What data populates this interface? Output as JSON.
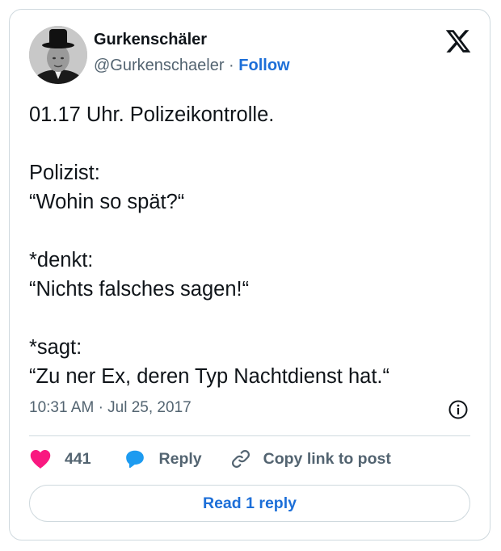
{
  "author": {
    "name": "Gurkenschäler",
    "handle": "@Gurkenschaeler",
    "separator": "·",
    "follow_label": "Follow",
    "avatar_icon": "profile-photo"
  },
  "brand_icon": "x-logo-icon",
  "post": {
    "lines": [
      "01.17 Uhr. Polizeikontrolle.",
      "Polizist:",
      "“Wohin so spät?“",
      "*denkt:",
      "“Nichts falsches sagen!“",
      "*sagt:",
      "“Zu ner Ex, deren Typ Nachtdienst hat.“"
    ]
  },
  "meta": {
    "time": "10:31 AM",
    "separator": "·",
    "date": "Jul 25, 2017"
  },
  "actions": {
    "likes": "441",
    "reply_label": "Reply",
    "copy_link_label": "Copy link to post"
  },
  "read_replies_label": "Read 1 reply",
  "colors": {
    "like": "#f91880",
    "reply": "#1d9bf0",
    "link_blue": "#1d6fd8",
    "muted": "#536471",
    "border": "#cfd9de"
  }
}
